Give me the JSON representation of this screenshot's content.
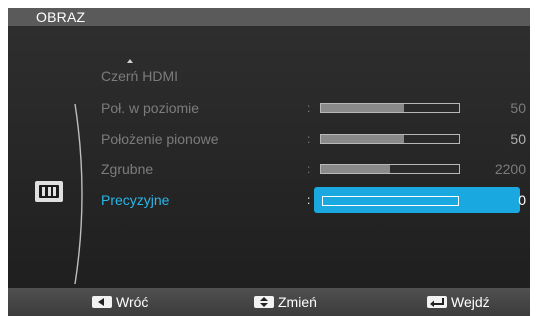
{
  "window": {
    "title": "OBRAZ"
  },
  "menu": {
    "items": [
      {
        "label": "Czerń HDMI"
      },
      {
        "label": "Poł. w poziomie",
        "value": "50",
        "level": 0.6
      },
      {
        "label": "Położenie pionowe",
        "value": "50",
        "level": 0.6
      },
      {
        "label": "Zgrubne",
        "value": "2200",
        "level": 0.5
      },
      {
        "label": "Precyzyjne",
        "value": "0",
        "level": 0.0,
        "selected": true
      }
    ],
    "separator": ":"
  },
  "icons": {
    "category": "picture-settings-icon",
    "scroll_up": "arrow-up-icon"
  },
  "footer": {
    "back_label": "Wróć",
    "change_label": "Zmień",
    "enter_label": "Wejdź"
  },
  "colors": {
    "accent": "#1aa8e0",
    "selected_text": "#29b6e8",
    "inactive_text": "#7c7c7c"
  }
}
